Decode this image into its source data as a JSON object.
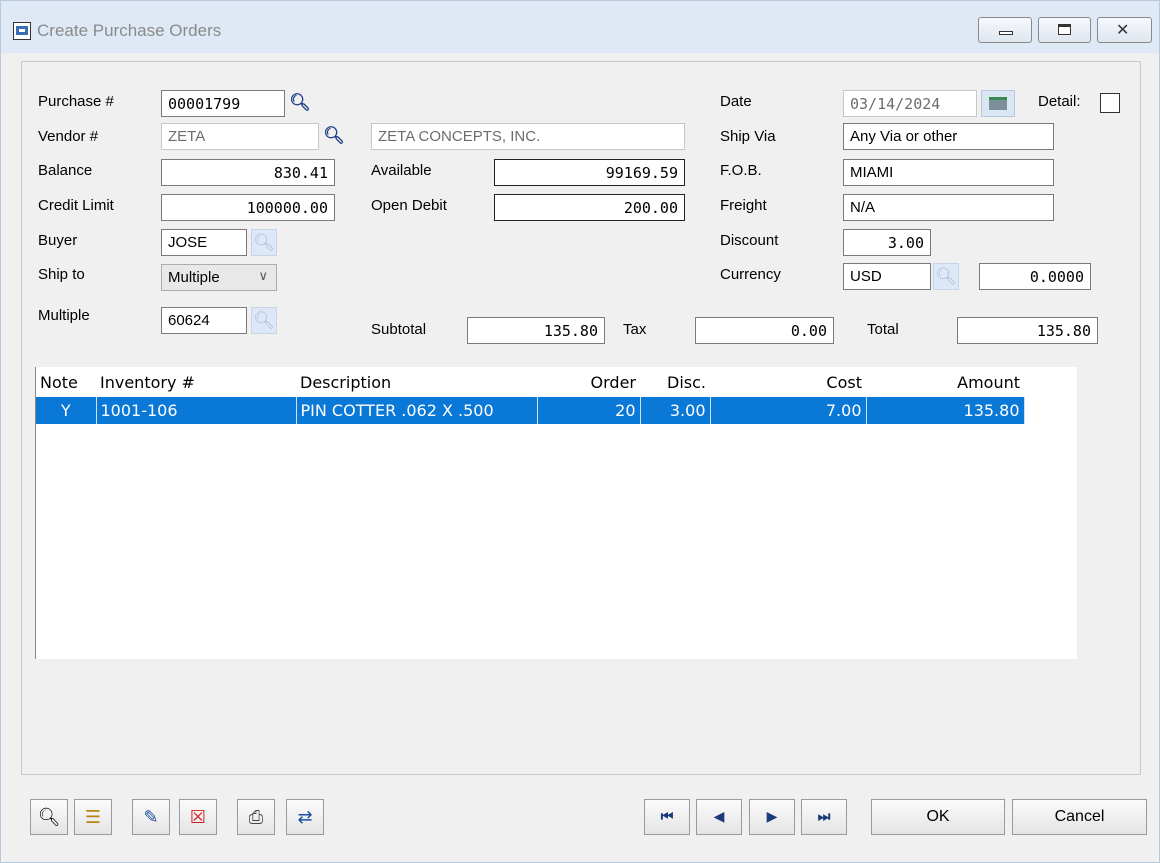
{
  "window": {
    "title": "Create Purchase Orders"
  },
  "form": {
    "purchase_label": "Purchase #",
    "purchase_value": "00001799",
    "vendor_label": "Vendor #",
    "vendor_value": "ZETA",
    "vendor_name": "ZETA CONCEPTS, INC.",
    "balance_label": "Balance",
    "balance_value": "830.41",
    "credit_label": "Credit Limit",
    "credit_value": "100000.00",
    "buyer_label": "Buyer",
    "buyer_value": "JOSE",
    "shipto_label": "Ship to",
    "shipto_value": "Multiple",
    "multiple_label": "Multiple",
    "multiple_value": "60624",
    "available_label": "Available",
    "available_value": "99169.59",
    "opendebit_label": "Open Debit",
    "opendebit_value": "200.00",
    "subtotal_label": "Subtotal",
    "subtotal_value": "135.80",
    "tax_label": "Tax",
    "tax_value": "0.00",
    "total_label": "Total",
    "total_value": "135.80",
    "date_label": "Date",
    "date_value": "03/14/2024",
    "detail_label": "Detail:",
    "shipvia_label": "Ship Via",
    "shipvia_value": "Any Via or other",
    "fob_label": "F.O.B.",
    "fob_value": "MIAMI",
    "freight_label": "Freight",
    "freight_value": "N/A",
    "discount_label": "Discount",
    "discount_value": "3.00",
    "currency_label": "Currency",
    "currency_value": "USD",
    "currency_rate": "0.0000"
  },
  "grid": {
    "headers": {
      "note": "Note",
      "inventory": "Inventory #",
      "description": "Description",
      "order": "Order",
      "disc": "Disc.",
      "cost": "Cost",
      "amount": "Amount"
    },
    "rows": [
      {
        "note": "Y",
        "inventory": "1001-106",
        "description": "PIN COTTER .062 X .500",
        "order": "20",
        "disc": "3.00",
        "cost": "7.00",
        "amount": "135.80"
      }
    ]
  },
  "buttons": {
    "ok": "OK",
    "cancel": "Cancel"
  },
  "icons": {
    "toolbar": [
      "search-tool-icon",
      "notes-icon",
      "edit-icon",
      "delete-icon",
      "print-icon",
      "export-icon"
    ],
    "nav": [
      "first-record-icon",
      "previous-record-icon",
      "next-record-icon",
      "last-record-icon"
    ]
  },
  "colors": {
    "selection": "#0a78d7",
    "title_bg": "#dfe9f5"
  }
}
